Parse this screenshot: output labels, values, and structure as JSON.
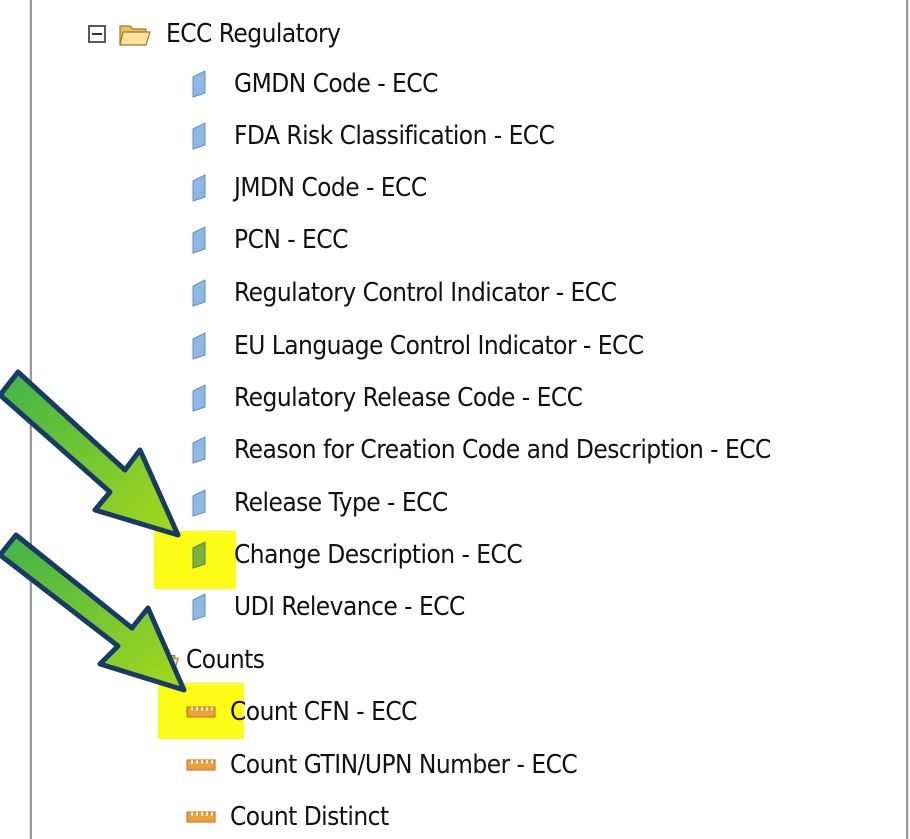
{
  "tree": {
    "folder_regulatory": {
      "label": "ECC Regulatory",
      "icon": "open-folder-icon",
      "expander_icon": "collapse-minus-icon"
    },
    "regulatory_items": [
      {
        "label": "GMDN Code - ECC",
        "icon": "attribute-icon"
      },
      {
        "label": "FDA Risk Classification - ECC",
        "icon": "attribute-icon"
      },
      {
        "label": "JMDN Code - ECC",
        "icon": "attribute-icon"
      },
      {
        "label": "PCN - ECC",
        "icon": "attribute-icon"
      },
      {
        "label": "Regulatory Control Indicator - ECC",
        "icon": "attribute-icon"
      },
      {
        "label": "EU Language Control Indicator - ECC",
        "icon": "attribute-icon"
      },
      {
        "label": "Regulatory Release Code - ECC",
        "icon": "attribute-icon"
      },
      {
        "label": "Reason for Creation Code and Description - ECC",
        "icon": "attribute-icon"
      },
      {
        "label": "Release Type - ECC",
        "icon": "attribute-icon"
      },
      {
        "label": "Change Description - ECC",
        "icon": "attribute-icon",
        "highlighted": true
      },
      {
        "label": "UDI Relevance - ECC",
        "icon": "attribute-icon"
      }
    ],
    "folder_counts": {
      "label": "Counts",
      "icon": "open-folder-icon"
    },
    "count_items": [
      {
        "label": "Count CFN - ECC",
        "icon": "measure-ruler-icon",
        "highlighted": true
      },
      {
        "label": "Count GTIN/UPN Number - ECC",
        "icon": "measure-ruler-icon"
      },
      {
        "label": "Count Distinct",
        "icon": "measure-ruler-icon"
      }
    ]
  },
  "annotations": {
    "arrow_icon": "green-arrow-icon",
    "highlight_color": "#fcfc16",
    "arrow_color": "#7cc21b"
  }
}
